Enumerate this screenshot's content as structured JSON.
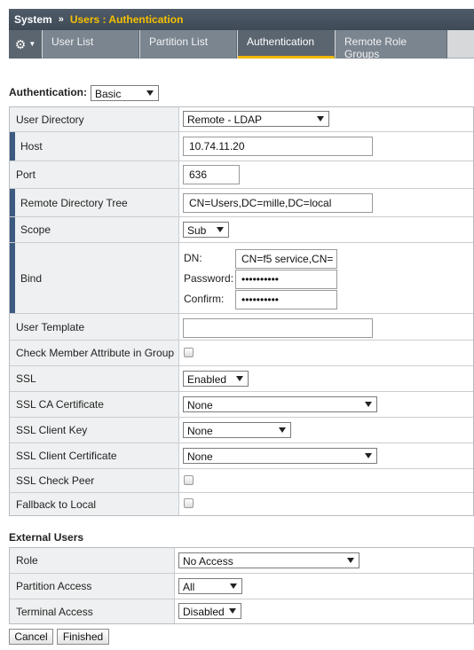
{
  "breadcrumb": {
    "system": "System",
    "separator": "»",
    "section": "Users : Authentication"
  },
  "tabs": [
    "User List",
    "Partition List",
    "Authentication",
    "Remote Role Groups"
  ],
  "auth": {
    "label": "Authentication:",
    "mode": "Basic"
  },
  "fields": {
    "user_directory": {
      "label": "User Directory",
      "value": "Remote - LDAP"
    },
    "host": {
      "label": "Host",
      "value": "10.74.11.20"
    },
    "port": {
      "label": "Port",
      "value": "636"
    },
    "remote_directory_tree": {
      "label": "Remote Directory Tree",
      "value": "CN=Users,DC=mille,DC=local"
    },
    "scope": {
      "label": "Scope",
      "value": "Sub"
    },
    "bind": {
      "label": "Bind",
      "dn_label": "DN:",
      "dn_value": "CN=f5 service,CN=",
      "password_label": "Password:",
      "password_value": "••••••••••",
      "confirm_label": "Confirm:",
      "confirm_value": "••••••••••"
    },
    "user_template": {
      "label": "User Template",
      "value": ""
    },
    "check_member": {
      "label": "Check Member Attribute in Group",
      "checked": false
    },
    "ssl": {
      "label": "SSL",
      "value": "Enabled"
    },
    "ssl_ca_certificate": {
      "label": "SSL CA Certificate",
      "value": "None"
    },
    "ssl_client_key": {
      "label": "SSL Client Key",
      "value": "None"
    },
    "ssl_client_certificate": {
      "label": "SSL Client Certificate",
      "value": "None"
    },
    "ssl_check_peer": {
      "label": "SSL Check Peer",
      "checked": false
    },
    "fallback_to_local": {
      "label": "Fallback to Local",
      "checked": false
    }
  },
  "external_users": {
    "header": "External Users",
    "role": {
      "label": "Role",
      "value": "No Access"
    },
    "partition_access": {
      "label": "Partition Access",
      "value": "All"
    },
    "terminal_access": {
      "label": "Terminal Access",
      "value": "Disabled"
    }
  },
  "buttons": {
    "cancel": "Cancel",
    "finished": "Finished"
  },
  "colors": {
    "accent": "#f0b800",
    "header_bg": "#4f5b69",
    "required_marker": "#3d5a80"
  },
  "icons": {
    "settings": "gear-icon",
    "menu": "chevron-down-icon"
  }
}
